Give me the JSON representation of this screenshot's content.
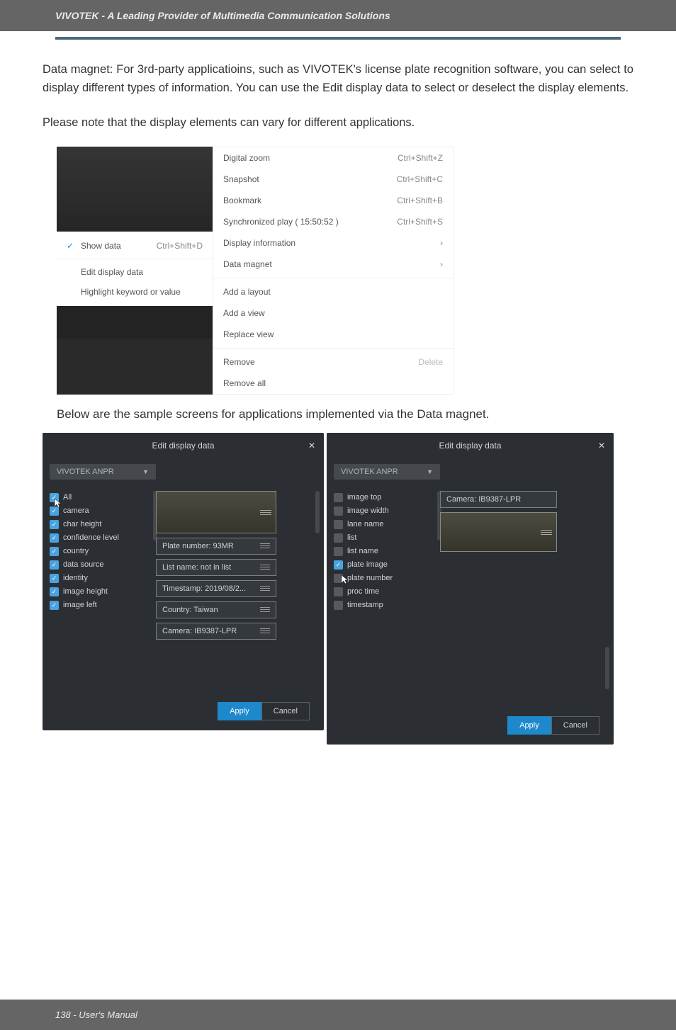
{
  "header": "VIVOTEK - A Leading Provider of Multimedia Communication Solutions",
  "p1": "Data magnet: For 3rd-party applicatioins, such as VIVOTEK's license plate recognition software, you can select to display different types of information. You can use the Edit display data to select or deselect the display elements.",
  "p2": "Please note that the display elements can vary for different applications.",
  "caption": "Below are the sample screens for applications implemented via the Data magnet.",
  "menu_left": {
    "show_data": "Show data",
    "show_data_sc": "Ctrl+Shift+D",
    "edit_display": "Edit display data",
    "highlight": "Highlight keyword or value"
  },
  "menu_right": {
    "r1": {
      "label": "Digital zoom",
      "sc": "Ctrl+Shift+Z"
    },
    "r2": {
      "label": "Snapshot",
      "sc": "Ctrl+Shift+C"
    },
    "r3": {
      "label": "Bookmark",
      "sc": "Ctrl+Shift+B"
    },
    "r4": {
      "label": "Synchronized play ( 15:50:52 )",
      "sc": "Ctrl+Shift+S"
    },
    "r5": {
      "label": "Display information"
    },
    "r6": {
      "label": "Data magnet"
    },
    "r7": {
      "label": "Add a layout"
    },
    "r8": {
      "label": "Add a view"
    },
    "r9": {
      "label": "Replace view"
    },
    "r10": {
      "label": "Remove",
      "sc": "Delete"
    },
    "r11": {
      "label": "Remove all"
    }
  },
  "dlgA": {
    "title": "Edit display data",
    "dropdown": "VIVOTEK ANPR",
    "items": {
      "i0": "All",
      "i1": "camera",
      "i2": "char height",
      "i3": "confidence level",
      "i4": "country",
      "i5": "data source",
      "i6": "identity",
      "i7": "image height",
      "i8": "image left"
    },
    "chips": {
      "c1": "Plate number: 93MR",
      "c2": "List name: not in list",
      "c3": "Timestamp: 2019/08/2...",
      "c4": "Country: Taiwan",
      "c5": "Camera: IB9387-LPR"
    },
    "apply": "Apply",
    "cancel": "Cancel"
  },
  "dlgB": {
    "title": "Edit display data",
    "dropdown": "VIVOTEK ANPR",
    "items": {
      "i0": "image top",
      "i1": "image width",
      "i2": "lane name",
      "i3": "list",
      "i4": "list name",
      "i5": "plate image",
      "i6": "plate number",
      "i7": "proc time",
      "i8": "timestamp"
    },
    "chip1": "Camera: IB9387-LPR",
    "apply": "Apply",
    "cancel": "Cancel"
  },
  "footer": "138 - User's Manual"
}
